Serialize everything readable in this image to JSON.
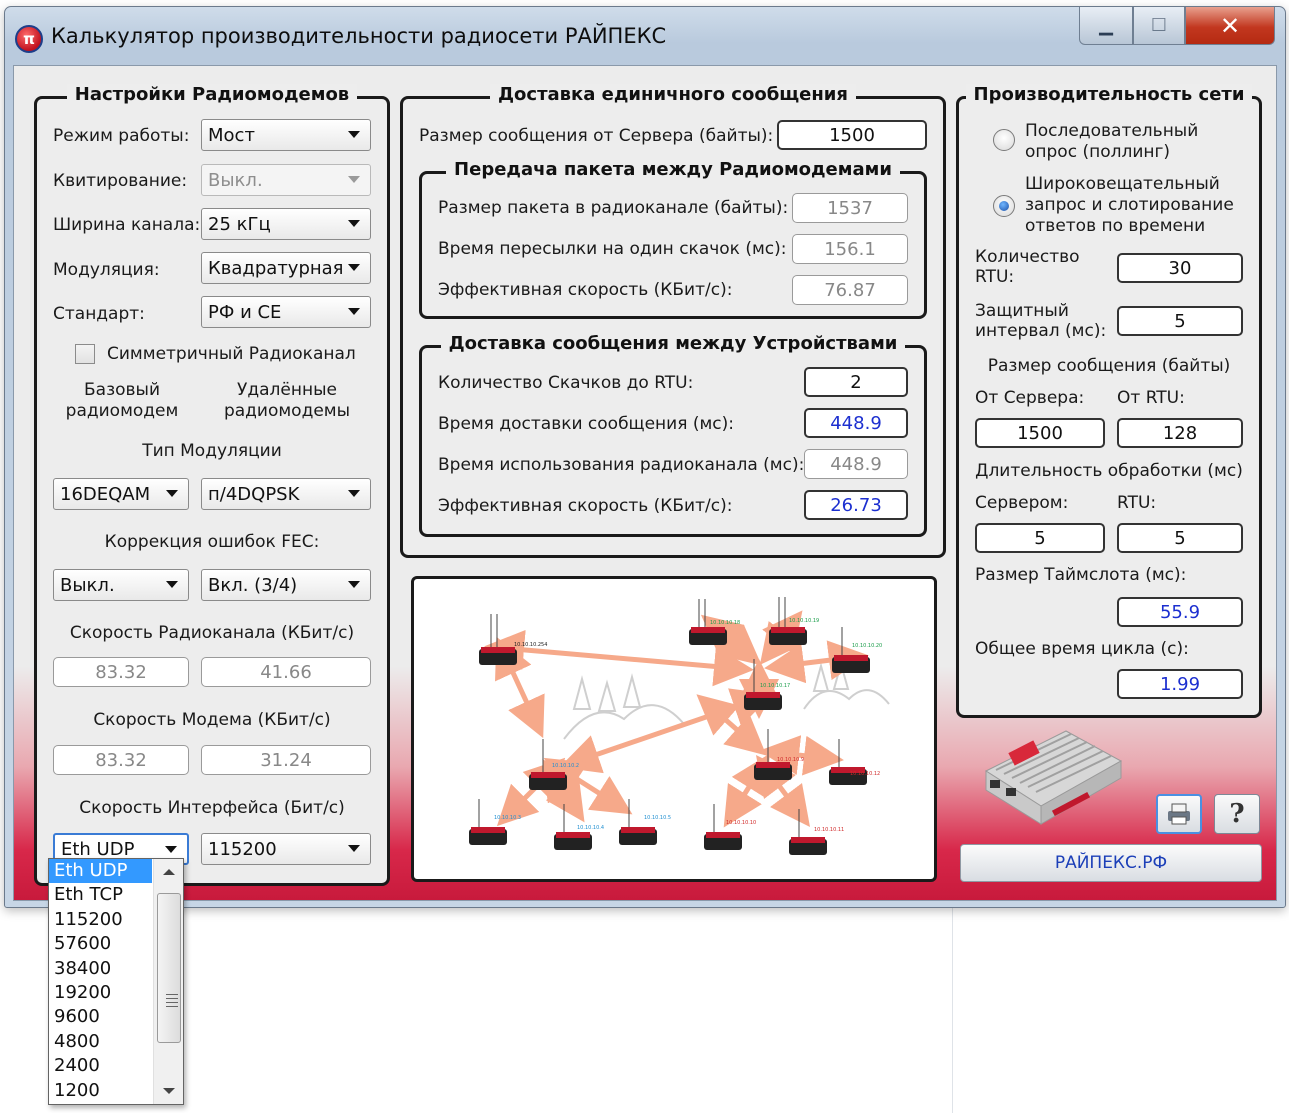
{
  "window": {
    "title": "Калькулятор производительности радиосети РАЙПЕКС",
    "icon": "π"
  },
  "radiomodems": {
    "title": "Настройки Радиомодемов",
    "mode_label": "Режим работы:",
    "mode_value": "Мост",
    "ack_label": "Квитирование:",
    "ack_value": "Выкл.",
    "width_label": "Ширина канала:",
    "width_value": "25 кГц",
    "mod_label": "Модуляция:",
    "mod_value": "Квадратурная",
    "std_label": "Стандарт:",
    "std_value": "РФ и CE",
    "symmetric_label": "Симметричный Радиоканал",
    "base_label": "Базовый радиомодем",
    "remote_label": "Удалённые радиомодемы",
    "modtype_label": "Тип Модуляции",
    "modtype_base": "16DEQAM",
    "modtype_remote": "п/4DQPSK",
    "fec_label": "Коррекция ошибок FEC:",
    "fec_base": "Выкл.",
    "fec_remote": "Вкл. (3/4)",
    "radio_speed_label": "Скорость Радиоканала (КБит/с)",
    "radio_speed_base": "83.32",
    "radio_speed_remote": "41.66",
    "modem_speed_label": "Скорость Модема (КБит/с)",
    "modem_speed_base": "83.32",
    "modem_speed_remote": "31.24",
    "iface_label": "Скорость Интерфейса (Бит/с)",
    "iface_value": "Eth UDP",
    "iface_baud": "115200"
  },
  "delivery": {
    "title": "Доставка единичного сообщения",
    "msg_size_label": "Размер сообщения от Сервера (байты):",
    "msg_size": "1500",
    "packet": {
      "title": "Передача пакета между Радиомодемами",
      "size_label": "Размер пакета в радиоканале (байты):",
      "size": "1537",
      "time_label": "Время пересылки на один скачок (мс):",
      "time": "156.1",
      "speed_label": "Эффективная скорость (КБит/с):",
      "speed": "76.87"
    },
    "devices": {
      "title": "Доставка сообщения между Устройствами",
      "hops_label": "Количество Скачков до RTU:",
      "hops": "2",
      "delivery_label": "Время доставки сообщения (мс):",
      "delivery": "448.9",
      "usage_label": "Время использования радиоканала (мс):",
      "usage": "448.9",
      "speed_label": "Эффективная скорость (КБит/с):",
      "speed": "26.73"
    }
  },
  "network": {
    "title": "Производительность сети",
    "poll_label": "Последовательный опрос (поллинг)",
    "broadcast_label": "Широковещательный запрос и слотирование ответов по времени",
    "rtu_count_label": "Количество RTU:",
    "rtu_count": "30",
    "guard_label": "Защитный интервал (мс):",
    "guard": "5",
    "msg_size_label": "Размер сообщения (байты)",
    "from_server_label": "От Сервера:",
    "from_rtu_label": "От RTU:",
    "from_server": "1500",
    "from_rtu": "128",
    "proc_label": "Длительность обработки (мс)",
    "server_label": "Сервером:",
    "rtu_label": "RTU:",
    "server_proc": "5",
    "rtu_proc": "5",
    "slot_label": "Размер Таймслота (мс):",
    "slot": "55.9",
    "cycle_label": "Общее время цикла (с):",
    "cycle": "1.99"
  },
  "diagram": {
    "addresses": [
      "10.10.10.254",
      "10.10.10.18",
      "10.10.10.19",
      "10.10.10.20",
      "10.10.10.17",
      "10.10.10.2",
      "10.10.10.9",
      "10.10.10.12",
      "10.10.10.3",
      "10.10.10.4",
      "10.10.10.5",
      "10.10.10.10",
      "10.10.10.11"
    ]
  },
  "footer": {
    "site_label": "РАЙПЕКС.РФ",
    "help_label": "?"
  },
  "dropdown": {
    "items": [
      "Eth UDP",
      "Eth TCP",
      "115200",
      "57600",
      "38400",
      "19200",
      "9600",
      "4800",
      "2400",
      "1200"
    ]
  },
  "colors": {
    "accent_red": "#c81a3c",
    "value_blue": "#1c2fd0",
    "link_blue": "#1c3fb8",
    "arrow": "#f6a98a"
  }
}
